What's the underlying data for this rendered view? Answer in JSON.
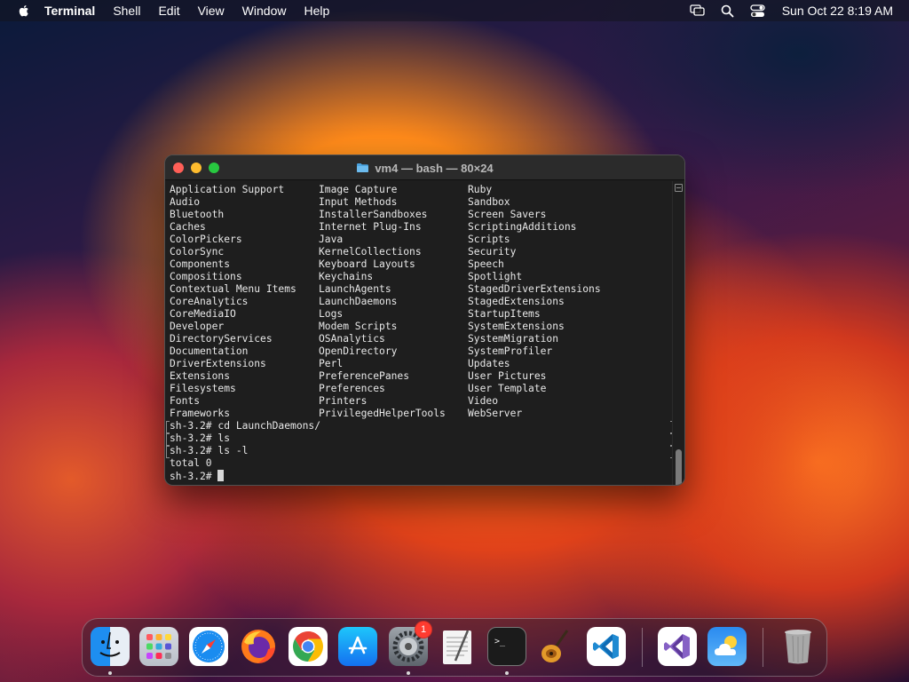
{
  "menubar": {
    "app_name": "Terminal",
    "items": [
      "Shell",
      "Edit",
      "View",
      "Window",
      "Help"
    ],
    "clock": "Sun Oct 22  8:19 AM"
  },
  "window": {
    "title": "vm4 — bash — 80×24"
  },
  "terminal": {
    "ls_rows": [
      [
        "Application Support",
        "Image Capture",
        "Ruby"
      ],
      [
        "Audio",
        "Input Methods",
        "Sandbox"
      ],
      [
        "Bluetooth",
        "InstallerSandboxes",
        "Screen Savers"
      ],
      [
        "Caches",
        "Internet Plug-Ins",
        "ScriptingAdditions"
      ],
      [
        "ColorPickers",
        "Java",
        "Scripts"
      ],
      [
        "ColorSync",
        "KernelCollections",
        "Security"
      ],
      [
        "Components",
        "Keyboard Layouts",
        "Speech"
      ],
      [
        "Compositions",
        "Keychains",
        "Spotlight"
      ],
      [
        "Contextual Menu Items",
        "LaunchAgents",
        "StagedDriverExtensions"
      ],
      [
        "CoreAnalytics",
        "LaunchDaemons",
        "StagedExtensions"
      ],
      [
        "CoreMediaIO",
        "Logs",
        "StartupItems"
      ],
      [
        "Developer",
        "Modem Scripts",
        "SystemExtensions"
      ],
      [
        "DirectoryServices",
        "OSAnalytics",
        "SystemMigration"
      ],
      [
        "Documentation",
        "OpenDirectory",
        "SystemProfiler"
      ],
      [
        "DriverExtensions",
        "Perl",
        "Updates"
      ],
      [
        "Extensions",
        "PreferencePanes",
        "User Pictures"
      ],
      [
        "Filesystems",
        "Preferences",
        "User Template"
      ],
      [
        "Fonts",
        "Printers",
        "Video"
      ],
      [
        "Frameworks",
        "PrivilegedHelperTools",
        "WebServer"
      ]
    ],
    "commands": [
      "sh-3.2# cd LaunchDaemons/",
      "sh-3.2# ls",
      "sh-3.2# ls -l"
    ],
    "output": "total 0",
    "prompt": "sh-3.2# "
  },
  "dock": {
    "items": [
      {
        "name": "Finder",
        "icon": "finder-icon",
        "running": true
      },
      {
        "name": "Launchpad",
        "icon": "launchpad-icon",
        "running": false
      },
      {
        "name": "Safari",
        "icon": "safari-icon",
        "running": false
      },
      {
        "name": "Firefox",
        "icon": "firefox-icon",
        "running": false
      },
      {
        "name": "Google Chrome",
        "icon": "chrome-icon",
        "running": false
      },
      {
        "name": "App Store",
        "icon": "app-store-icon",
        "running": false
      },
      {
        "name": "System Settings",
        "icon": "system-settings-icon",
        "running": true,
        "badge": "1"
      },
      {
        "name": "TextEdit",
        "icon": "textedit-icon",
        "running": false
      },
      {
        "name": "Terminal",
        "icon": "terminal-icon",
        "running": true
      },
      {
        "name": "GarageBand",
        "icon": "garageband-icon",
        "running": false
      },
      {
        "name": "Visual Studio Code",
        "icon": "vscode-icon",
        "running": false
      },
      {
        "name": "Visual Studio",
        "icon": "visual-studio-icon",
        "running": false
      },
      {
        "name": "Weather",
        "icon": "weather-icon",
        "running": false
      },
      {
        "name": "Trash",
        "icon": "trash-icon",
        "running": false
      }
    ]
  },
  "colors": {
    "terminal_bg": "#1e1e1e",
    "terminal_text": "#e8e8e8",
    "close": "#ff5f57",
    "minimize": "#febc2e",
    "zoom": "#28c840",
    "badge": "#ff3b30"
  }
}
